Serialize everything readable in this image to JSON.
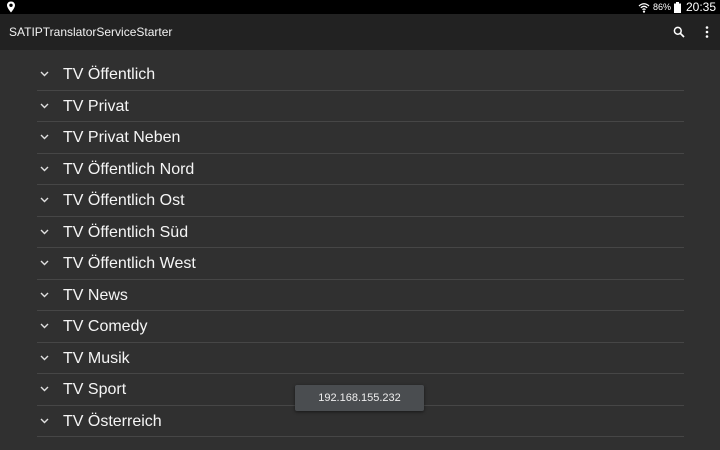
{
  "status_bar": {
    "battery_percent": "86%",
    "time": "20:35",
    "icons": [
      "location-icon",
      "wifi-icon",
      "battery-icon"
    ]
  },
  "action_bar": {
    "title": "SATIPTranslatorServiceStarter",
    "icons": [
      "search-icon",
      "overflow-menu-icon"
    ]
  },
  "groups": [
    {
      "label": "TV Öffentlich"
    },
    {
      "label": "TV Privat"
    },
    {
      "label": "TV Privat Neben"
    },
    {
      "label": "TV Öffentlich Nord"
    },
    {
      "label": "TV Öffentlich Ost"
    },
    {
      "label": "TV Öffentlich Süd"
    },
    {
      "label": "TV Öffentlich West"
    },
    {
      "label": "TV News"
    },
    {
      "label": "TV Comedy"
    },
    {
      "label": "TV Musik"
    },
    {
      "label": "TV Sport"
    },
    {
      "label": "TV Österreich"
    }
  ],
  "toast": {
    "text": "192.168.155.232"
  },
  "colors": {
    "background": "#303030",
    "action_bar": "#222222",
    "status_bar": "#000000",
    "divider": "#464646",
    "toast": "#4a4d50"
  }
}
